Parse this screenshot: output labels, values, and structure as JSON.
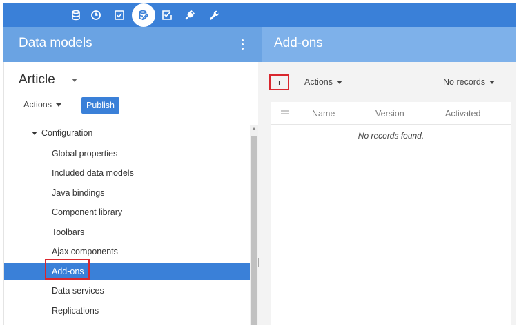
{
  "topbar": {
    "icons": [
      "database-icon",
      "clock-icon",
      "checkbox-icon",
      "data-model-icon",
      "task-edit-icon",
      "plug-icon",
      "wrench-icon"
    ],
    "active": "data-model-icon",
    "color": "#3a80d8"
  },
  "left_panel": {
    "title": "Data models",
    "model_name": "Article",
    "actions_label": "Actions",
    "publish_label": "Publish",
    "tree_root": "Configuration",
    "tree_items": [
      "Global properties",
      "Included data models",
      "Java bindings",
      "Component library",
      "Toolbars",
      "Ajax components",
      "Add-ons",
      "Data services",
      "Replications"
    ],
    "selected_item": "Add-ons"
  },
  "right_panel": {
    "title": "Add-ons",
    "add_label": "+",
    "actions_label": "Actions",
    "records_label": "No records",
    "columns": [
      "Name",
      "Version",
      "Activated"
    ],
    "empty_message": "No records found."
  },
  "colors": {
    "accent": "#3a80d8",
    "left_header": "#6aa3e3",
    "right_header": "#7eb1ea",
    "highlight": "#d9272e"
  }
}
